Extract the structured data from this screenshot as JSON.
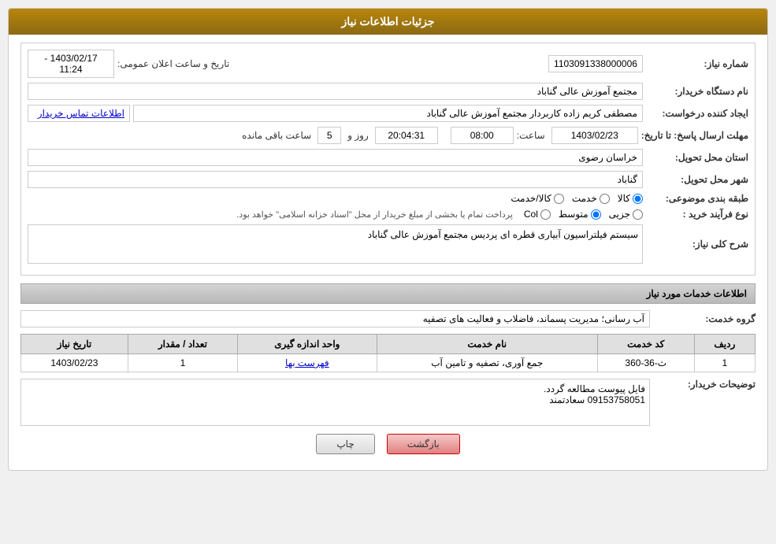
{
  "header": {
    "title": "جزئیات اطلاعات نیاز"
  },
  "fields": {
    "need_number_label": "شماره نیاز:",
    "need_number_value": "1103091338000006",
    "announcement_date_label": "تاریخ و ساعت اعلان عمومی:",
    "announcement_date_value": "1403/02/17 - 11:24",
    "buyer_org_label": "نام دستگاه خریدار:",
    "buyer_org_value": "مجتمع آموزش عالی گناباد",
    "creator_label": "ایجاد کننده درخواست:",
    "creator_value": "مصطفی کریم زاده کاربردار مجتمع آموزش عالی گناباد",
    "creator_link": "اطلاعات تماس خریدار",
    "response_deadline_label": "مهلت ارسال پاسخ: تا تاریخ:",
    "response_date_value": "1403/02/23",
    "response_time_label": "ساعت:",
    "response_time_value": "08:00",
    "remaining_days_label": "روز و",
    "remaining_days_value": "5",
    "remaining_time_value": "20:04:31",
    "remaining_suffix": "ساعت باقی مانده",
    "delivery_province_label": "استان محل تحویل:",
    "delivery_province_value": "خراسان رضوی",
    "delivery_city_label": "شهر محل تحویل:",
    "delivery_city_value": "گناباد",
    "category_label": "طبقه بندی موضوعی:",
    "category_options": [
      {
        "label": "کالا",
        "value": "kala"
      },
      {
        "label": "خدمت",
        "value": "khedmat"
      },
      {
        "label": "کالا/خدمت",
        "value": "both"
      }
    ],
    "category_selected": "kala",
    "purchase_type_label": "نوع فرآیند خرید :",
    "purchase_type_options": [
      {
        "label": "جزیی",
        "value": "jozi"
      },
      {
        "label": "متوسط",
        "value": "motevaset"
      },
      {
        "label": "text_col",
        "value": "col"
      }
    ],
    "purchase_type_selected": "motevaset",
    "purchase_type_desc": "پرداخت تمام یا بخشی از مبلغ خریدار از محل \"اسناد خزانه اسلامی\" خواهد بود.",
    "need_desc_label": "شرح کلی نیاز:",
    "need_desc_value": "سیستم فیلتراسیون آبیاری قطره ای پردیس مجتمع آموزش عالی گناباد",
    "services_title": "اطلاعات خدمات مورد نیاز",
    "service_group_label": "گروه خدمت:",
    "service_group_value": "آب رسانی؛ مدیریت پسماند، فاضلاب و فعالیت های تصفیه",
    "table": {
      "headers": [
        "ردیف",
        "کد خدمت",
        "نام خدمت",
        "واحد اندازه گیری",
        "تعداد / مقدار",
        "تاریخ نیاز"
      ],
      "rows": [
        {
          "row": "1",
          "code": "ث-36-360",
          "name": "جمع آوری، تصفیه و تامین آب",
          "unit": "فهرست بها",
          "quantity": "1",
          "date": "1403/02/23"
        }
      ]
    },
    "buyer_notes_label": "توضیحات خریدار:",
    "buyer_notes_value": "فایل پیوست مطالعه گردد.\n09153758051 سعادتمند"
  },
  "buttons": {
    "print": "چاپ",
    "back": "بازگشت"
  }
}
